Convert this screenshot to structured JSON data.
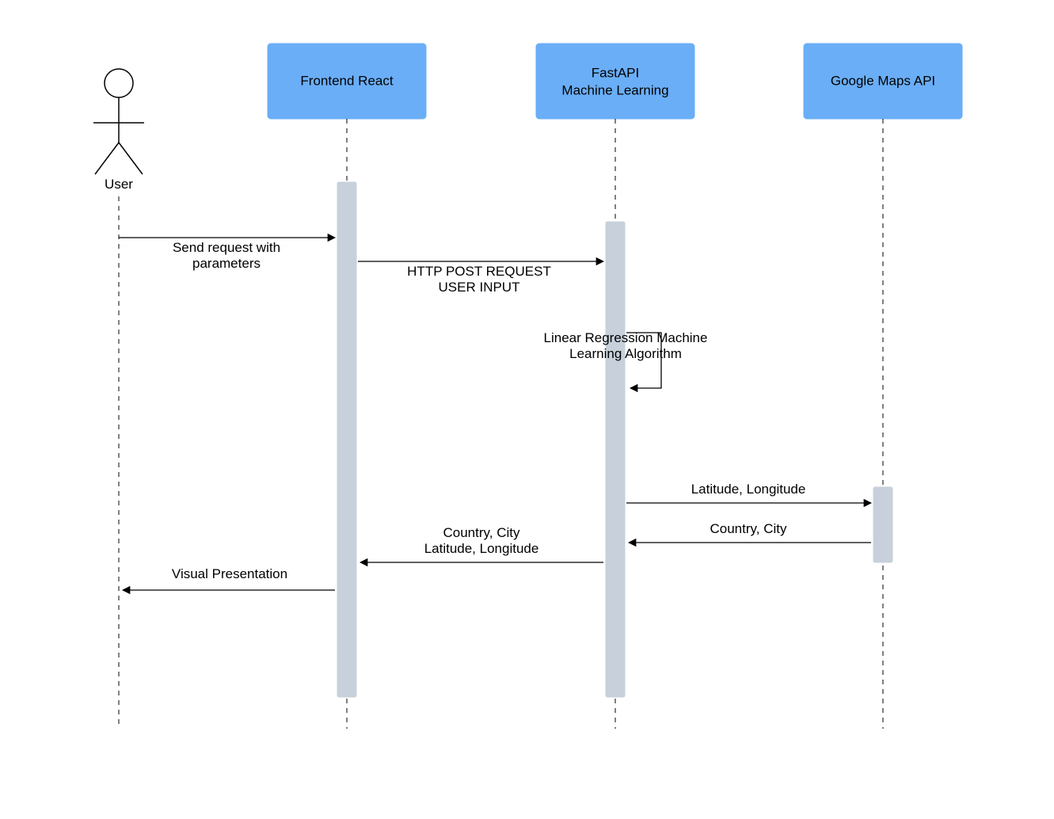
{
  "diagram": {
    "type": "sequence",
    "actor": {
      "label": "User"
    },
    "participants": [
      {
        "label": "Frontend React"
      },
      {
        "label_line1": "FastAPI",
        "label_line2": "Machine Learning"
      },
      {
        "label": "Google Maps API"
      }
    ],
    "messages": {
      "m1_line1": "Send request with",
      "m1_line2": "parameters",
      "m2_line1": "HTTP POST REQUEST",
      "m2_line2": "USER INPUT",
      "self_line1": "Linear Regression Machine",
      "self_line2": "Learning Algorithm",
      "m3": "Latitude, Longitude",
      "m4": "Country, City",
      "m5_line1": "Country, City",
      "m5_line2": "Latitude, Longitude",
      "m6": "Visual Presentation"
    }
  }
}
